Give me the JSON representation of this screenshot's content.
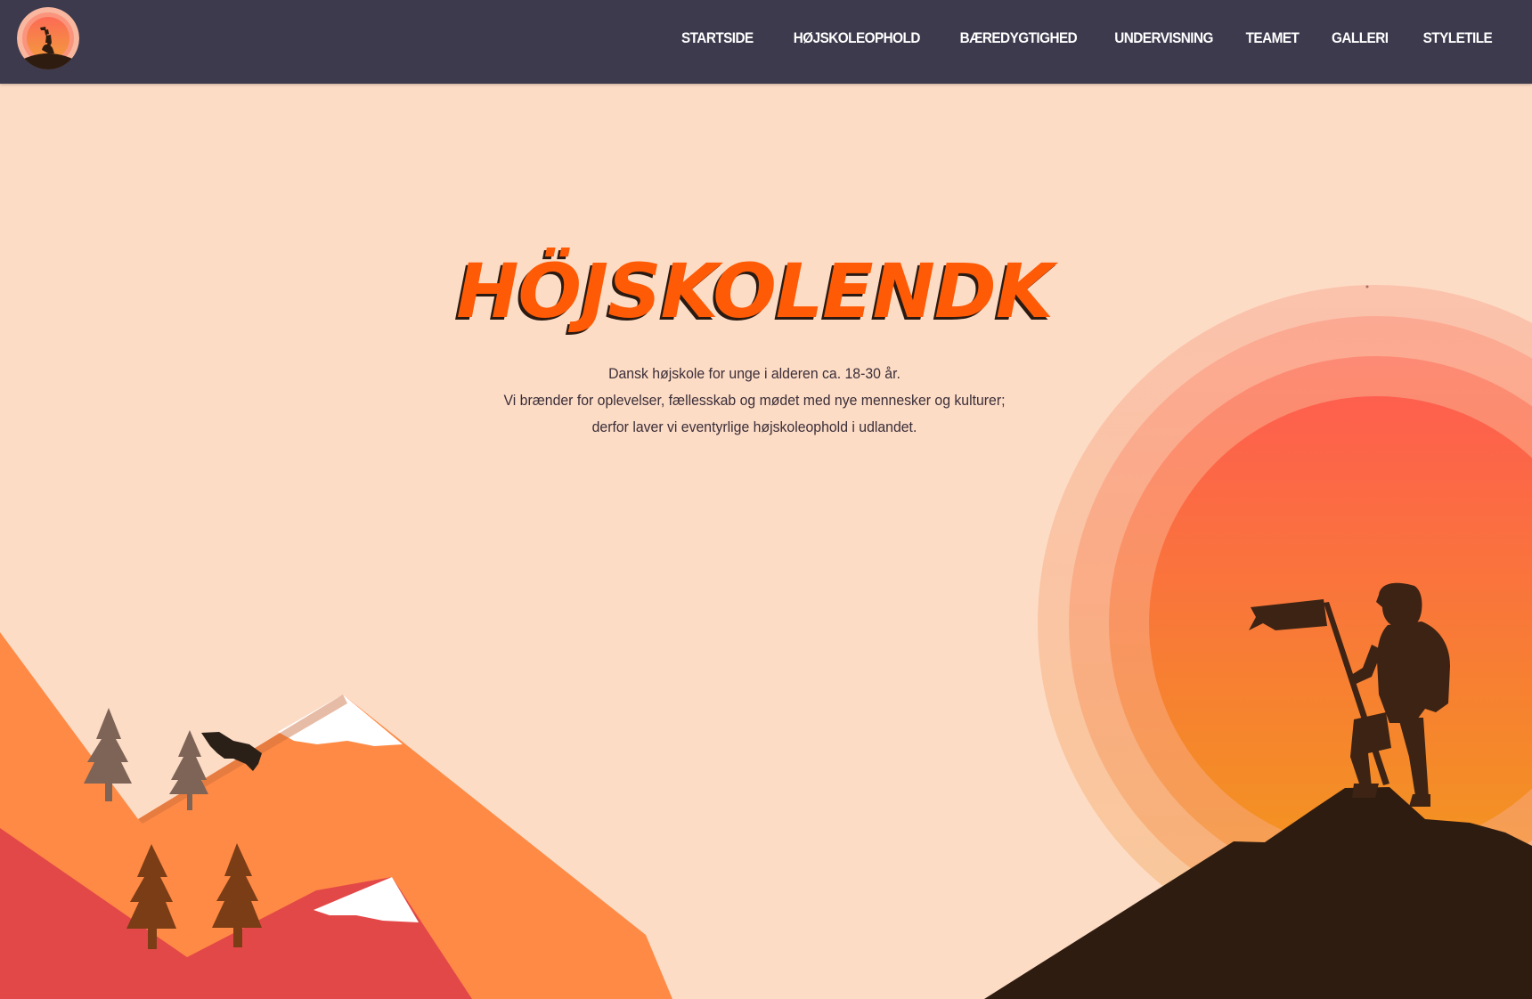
{
  "colors": {
    "nav_background": "#3d3a4d",
    "page_background": "#fddcc6",
    "title": "#ff5a05",
    "body_text": "#3a2e38"
  },
  "nav": {
    "logo_icon": "hiker-sunset-logo-icon",
    "items": [
      {
        "label": "STARTSIDE"
      },
      {
        "label": "HØJSKOLEOPHOLD"
      },
      {
        "label": "BÆREDYGTIGHED"
      },
      {
        "label": "UNDERVISNING"
      },
      {
        "label": "TEAMET"
      },
      {
        "label": "GALLERI"
      },
      {
        "label": "STYLETILE"
      }
    ]
  },
  "hero": {
    "title": "HÖJSKOLENDK",
    "lines": [
      "Dansk højskole for unge i alderen ca. 18-30 år.",
      "Vi brænder for oplevelser, fællesskab og mødet med nye mennesker og kulturer;",
      "derfor laver vi eventyrlige højskoleophold i udlandet."
    ]
  },
  "illustration": {
    "icons": [
      "sunset-icon",
      "hiker-with-flag-icon",
      "mountains-icon",
      "pine-tree-icon",
      "eagle-icon"
    ]
  }
}
